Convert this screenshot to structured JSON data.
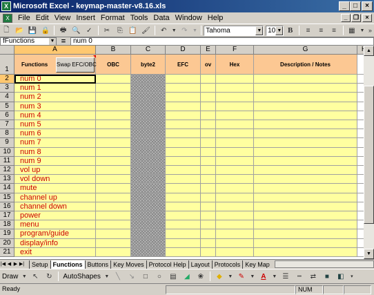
{
  "window": {
    "title": "Microsoft Excel - keymap-master-v8.16.xls"
  },
  "menu": [
    "File",
    "Edit",
    "View",
    "Insert",
    "Format",
    "Tools",
    "Data",
    "Window",
    "Help"
  ],
  "toolbar": {
    "font": "Tahoma",
    "size": "10"
  },
  "formula": {
    "name_box": "fFunctions",
    "eq": "=",
    "content": "num 0"
  },
  "columns": [
    "A",
    "B",
    "C",
    "D",
    "E",
    "F",
    "G",
    "H"
  ],
  "header_row": {
    "row": "1",
    "functions": "Functions",
    "swap_button": "Swap EFC/OBC",
    "obc": "OBC",
    "byte2": "byte2",
    "efc": "EFC",
    "ov": "ov",
    "hex": "Hex",
    "desc": "Description / Notes"
  },
  "rows": [
    {
      "num": "2",
      "fn": "num 0"
    },
    {
      "num": "3",
      "fn": "num 1"
    },
    {
      "num": "4",
      "fn": "num 2"
    },
    {
      "num": "5",
      "fn": "num 3"
    },
    {
      "num": "6",
      "fn": "num 4"
    },
    {
      "num": "7",
      "fn": "num 5"
    },
    {
      "num": "8",
      "fn": "num 6"
    },
    {
      "num": "9",
      "fn": "num 7"
    },
    {
      "num": "10",
      "fn": "num 8"
    },
    {
      "num": "11",
      "fn": "num 9"
    },
    {
      "num": "12",
      "fn": "vol up"
    },
    {
      "num": "13",
      "fn": "vol down"
    },
    {
      "num": "14",
      "fn": "mute"
    },
    {
      "num": "15",
      "fn": "channel up"
    },
    {
      "num": "16",
      "fn": "channel down"
    },
    {
      "num": "17",
      "fn": "power"
    },
    {
      "num": "18",
      "fn": "menu"
    },
    {
      "num": "19",
      "fn": "program/guide"
    },
    {
      "num": "20",
      "fn": "display/info"
    },
    {
      "num": "21",
      "fn": "exit"
    }
  ],
  "sheet_tabs": [
    "Setup",
    "Functions",
    "Buttons",
    "Key Moves",
    "Protocol Help",
    "Layout",
    "Protocols",
    "Key Map"
  ],
  "active_tab": "Functions",
  "drawing": {
    "draw": "Draw",
    "autoshapes": "AutoShapes"
  },
  "status": {
    "text": "Ready",
    "num": "NUM"
  }
}
